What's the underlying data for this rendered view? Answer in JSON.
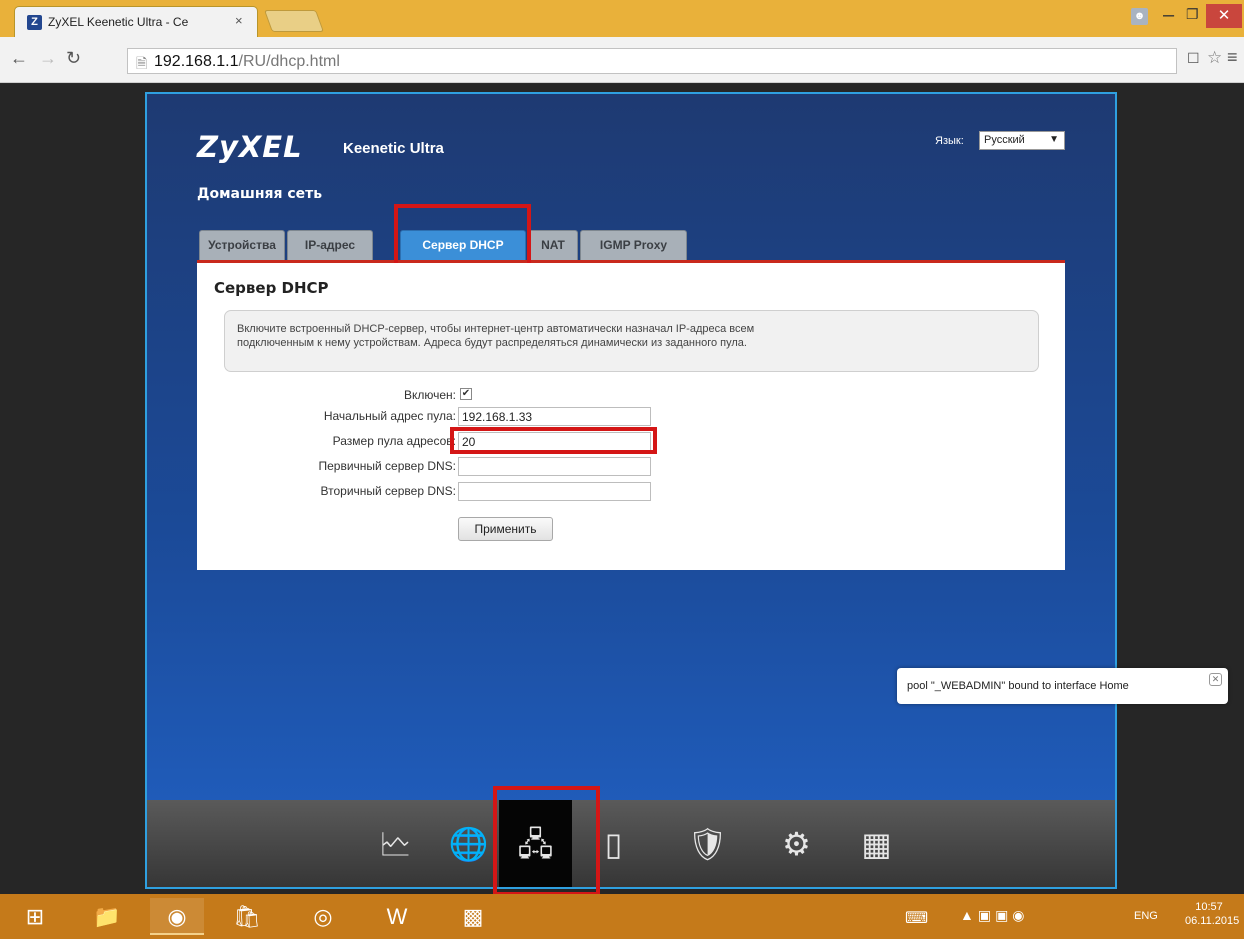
{
  "browser": {
    "tab_title": "ZyXEL Keenetic Ultra - Се",
    "tab_close": "×",
    "url_host": "192.168.1.1",
    "url_path": "/RU/dhcp.html",
    "window_user_icon": "user-icon",
    "window_min": "–",
    "window_max": "❐",
    "window_close": "✕"
  },
  "router": {
    "brand": "ZyXEL",
    "model": "Keenetic Ultra",
    "language_label": "Язык:",
    "language_value": "Русский",
    "section": "Домашняя сеть",
    "tabs": [
      {
        "label": "Устройства",
        "active": false
      },
      {
        "label": "IP-адрес",
        "active": false
      },
      {
        "label": "Сервер DHCP",
        "active": true
      },
      {
        "label": "NAT",
        "active": false
      },
      {
        "label": "IGMP Proxy",
        "active": false
      }
    ],
    "panel_title": "Сервер DHCP",
    "info_line1": "Включите встроенный DHCP-сервер, чтобы интернет-центр автоматически назначал IP-адреса всем",
    "info_line2": "подключенным к нему устройствам. Адреса будут распределяться динамически из заданного пула.",
    "form": {
      "enabled_label": "Включен:",
      "enabled_value": true,
      "pool_start_label": "Начальный адрес пула:",
      "pool_start_value": "192.168.1.33",
      "pool_size_label": "Размер пула адресов:",
      "pool_size_value": "20",
      "dns_primary_label": "Первичный сервер DNS:",
      "dns_primary_value": "",
      "dns_secondary_label": "Вторичный сервер DNS:",
      "dns_secondary_value": "",
      "apply_label": "Применить"
    },
    "notification": "pool \"_WEBADMIN\" bound to interface Home",
    "bottom_nav": [
      {
        "icon": "monitor-chart-icon",
        "active": false
      },
      {
        "icon": "globe-icon",
        "active": false
      },
      {
        "icon": "home-network-icon",
        "active": true
      },
      {
        "icon": "wifi-signal-icon",
        "active": false
      },
      {
        "icon": "security-shield-icon",
        "active": false
      },
      {
        "icon": "system-gear-icon",
        "active": false
      },
      {
        "icon": "apps-grid-icon",
        "active": false
      }
    ],
    "highlight_color": "#d41616"
  },
  "taskbar": {
    "apps": [
      "windows-start-icon",
      "file-explorer-icon",
      "chrome-icon",
      "store-icon",
      "eye-app-icon",
      "word-icon",
      "remote-desktop-icon"
    ],
    "lang": "ENG",
    "time": "10:57",
    "date": "06.11.2015"
  }
}
